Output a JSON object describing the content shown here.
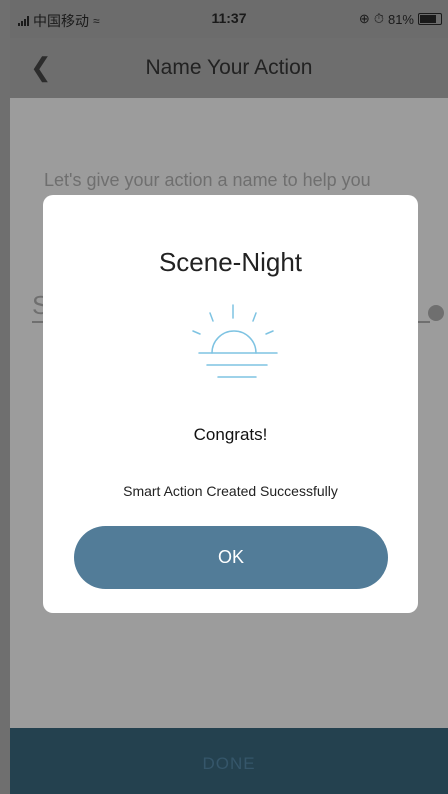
{
  "status_bar": {
    "carrier": "中国移动",
    "time": "11:37",
    "battery": "81%"
  },
  "nav": {
    "title": "Name Your Action",
    "back_icon": "chevron-left-icon"
  },
  "page": {
    "hint": "Let's give your action a name to help you",
    "field_prefix": "S",
    "done_label": "DONE"
  },
  "modal": {
    "title": "Scene-Night",
    "icon": "sunrise-icon",
    "heading": "Congrats!",
    "message": "Smart Action Created Successfully",
    "ok_label": "OK"
  },
  "colors": {
    "accent": "#527c98",
    "done_bar": "#24414f",
    "sun_line": "#7ec3e2"
  }
}
